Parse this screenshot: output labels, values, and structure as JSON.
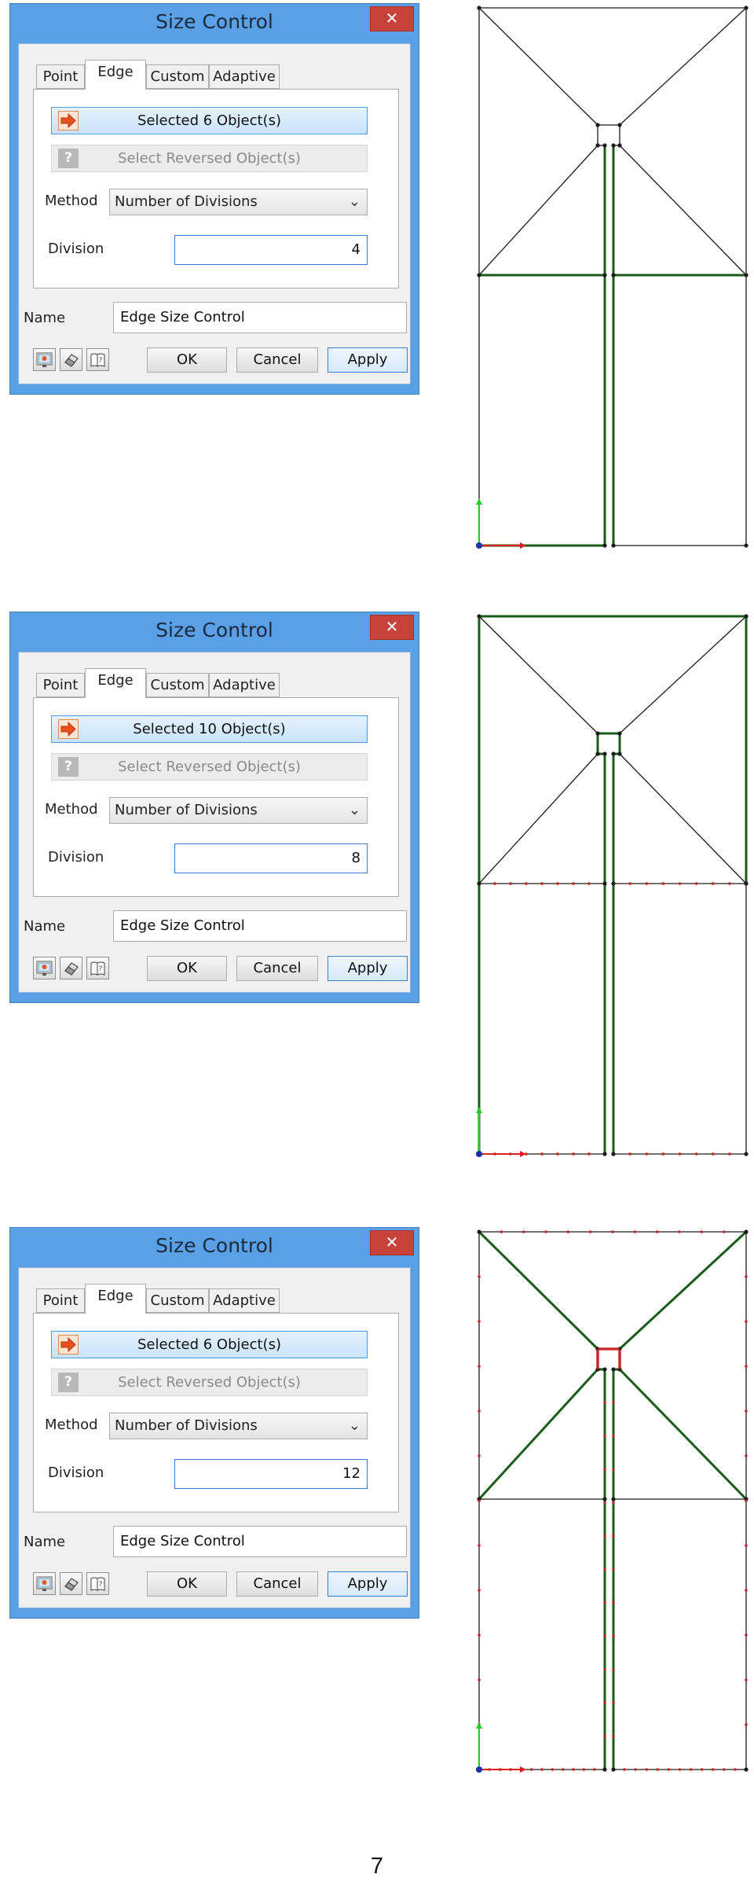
{
  "dialogs": [
    {
      "title": "Size Control",
      "close_glyph": "✕",
      "tabs": [
        "Point",
        "Edge",
        "Custom",
        "Adaptive"
      ],
      "active_tab": "Edge",
      "selected_label": "Selected 6 Object(s)",
      "reversed_label": "Select Reversed Object(s)",
      "method_label": "Method",
      "method_value": "Number of Divisions",
      "division_label": "Division",
      "division_value": "4",
      "name_label": "Name",
      "name_value": "Edge Size Control",
      "ok_label": "OK",
      "cancel_label": "Cancel",
      "apply_label": "Apply"
    },
    {
      "title": "Size Control",
      "close_glyph": "✕",
      "tabs": [
        "Point",
        "Edge",
        "Custom",
        "Adaptive"
      ],
      "active_tab": "Edge",
      "selected_label": "Selected 10 Object(s)",
      "reversed_label": "Select Reversed Object(s)",
      "method_label": "Method",
      "method_value": "Number of Divisions",
      "division_label": "Division",
      "division_value": "8",
      "name_label": "Name",
      "name_value": "Edge Size Control",
      "ok_label": "OK",
      "cancel_label": "Cancel",
      "apply_label": "Apply"
    },
    {
      "title": "Size Control",
      "close_glyph": "✕",
      "tabs": [
        "Point",
        "Edge",
        "Custom",
        "Adaptive"
      ],
      "active_tab": "Edge",
      "selected_label": "Selected 6 Object(s)",
      "reversed_label": "Select Reversed Object(s)",
      "method_label": "Method",
      "method_value": "Number of Divisions",
      "division_label": "Division",
      "division_value": "12",
      "name_label": "Name",
      "name_value": "Edge Size Control",
      "ok_label": "OK",
      "cancel_label": "Cancel",
      "apply_label": "Apply"
    }
  ],
  "icons": {
    "selected": "red-arrow-icon",
    "reversed": "question-icon",
    "tools": [
      "preview-icon",
      "eraser-icon",
      "help-book-icon"
    ],
    "dropdown": "chevron-down-icon"
  },
  "colors": {
    "dialog_frame": "#5aa0e6",
    "close_button": "#c7423b",
    "selected_edge": "#1a5c1a",
    "division_tick": "#cc2222",
    "axis_x": "#e02020",
    "axis_y": "#22cc22",
    "origin": "#1a2fb0"
  },
  "page_number": "7"
}
